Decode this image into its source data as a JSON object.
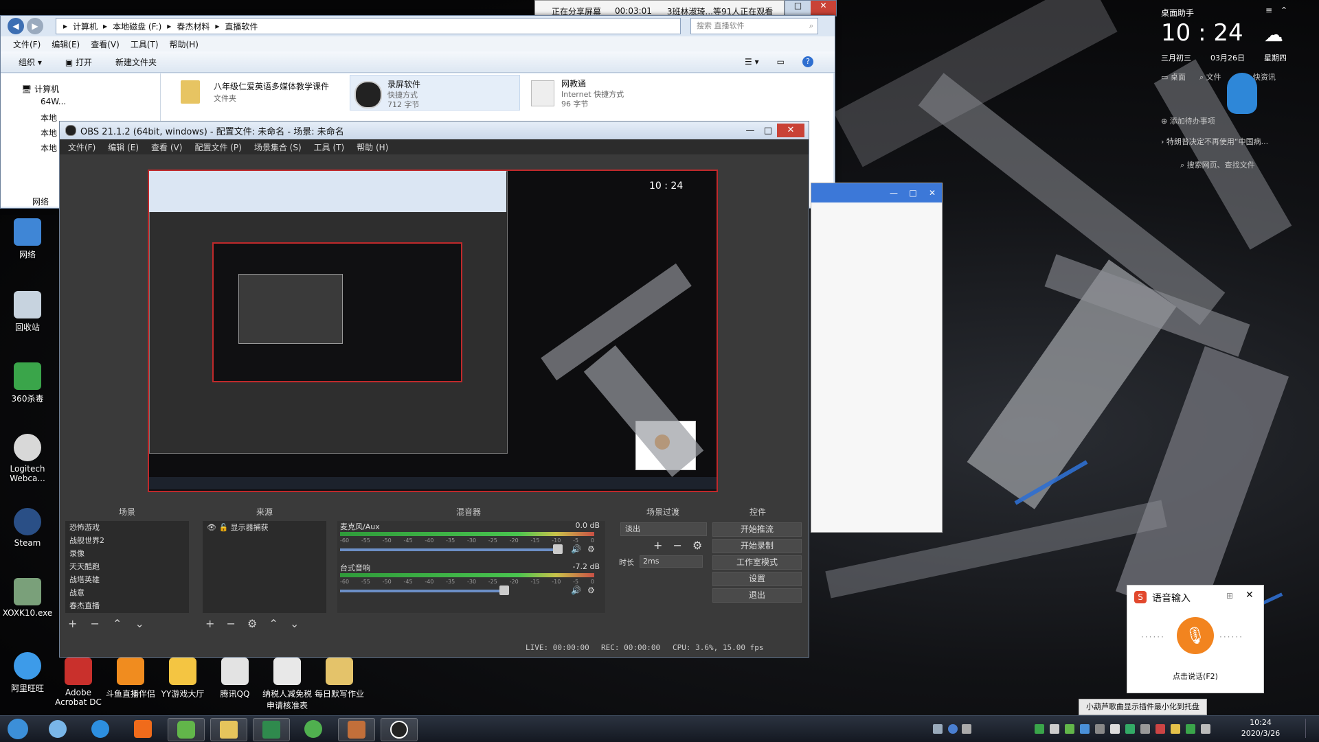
{
  "share_bar": {
    "status": "正在分享屏幕",
    "timer": "00:03:01",
    "viewers": "3班林淑琦...等91人正在观看"
  },
  "explorer": {
    "breadcrumb": [
      "计算机",
      "本地磁盘 (F:)",
      "春杰材料",
      "直播软件"
    ],
    "search_placeholder": "搜索 直播软件",
    "menu": [
      "文件(F)",
      "编辑(E)",
      "查看(V)",
      "工具(T)",
      "帮助(H)"
    ],
    "toolbar": {
      "organize": "组织 ▾",
      "open": "打开",
      "new_folder": "新建文件夹"
    },
    "tree": [
      "计算机",
      "64W...",
      "本地",
      "本地",
      "本地",
      "网络"
    ],
    "files": [
      {
        "name": "八年级仁爱英语多媒体教学课件",
        "type": "文件夹",
        "size": ""
      },
      {
        "name": "录屏软件",
        "type": "快捷方式",
        "size": "712 字节"
      },
      {
        "name": "网教通",
        "type": "Internet 快捷方式",
        "size": "96 字节"
      }
    ]
  },
  "obs": {
    "title": "OBS 21.1.2 (64bit, windows) - 配置文件: 未命名 - 场景: 未命名",
    "menu": [
      "文件(F)",
      "编辑 (E)",
      "查看 (V)",
      "配置文件 (P)",
      "场景集合 (S)",
      "工具 (T)",
      "帮助 (H)"
    ],
    "panels": {
      "scenes_header": "场景",
      "sources_header": "来源",
      "mixer_header": "混音器",
      "transitions_header": "场景过渡",
      "controls_header": "控件"
    },
    "scenes": [
      "恐怖游戏",
      "战舰世界2",
      "录像",
      "天天酷跑",
      "战塔英雄",
      "战意",
      "春杰直播"
    ],
    "sources": [
      {
        "name": "显示器捕获"
      }
    ],
    "mixer": [
      {
        "name": "麦克风/Aux",
        "db": "0.0 dB",
        "level": 0.85
      },
      {
        "name": "台式音响",
        "db": "-7.2 dB",
        "level": 0.62
      }
    ],
    "meter_ticks": [
      "-60",
      "-55",
      "-50",
      "-45",
      "-40",
      "-35",
      "-30",
      "-25",
      "-20",
      "-15",
      "-10",
      "-5",
      "0"
    ],
    "transition": {
      "type": "淡出",
      "duration_label": "时长",
      "duration": "2ms"
    },
    "controls": [
      "开始推流",
      "开始录制",
      "工作室模式",
      "设置",
      "退出"
    ],
    "status": {
      "live": "LIVE: 00:00:00",
      "rec": "REC: 00:00:00",
      "cpu": "CPU: 3.6%, 15.00 fps"
    }
  },
  "widget": {
    "title": "桌面助手",
    "time": "10 : 24",
    "lunar": "三月初三",
    "date": "03月26日",
    "weekday": "星期四",
    "row1": [
      "桌面",
      "文件",
      "快资讯"
    ],
    "todo": "添加待办事项",
    "news": "特朗普决定不再使用“中国病...",
    "search": "搜索网页、查找文件"
  },
  "voice_input": {
    "title": "语音输入",
    "hint": "点击说话(F2)",
    "tooltip": "小葫芦歌曲显示插件最小化到托盘"
  },
  "desktop_icons": [
    {
      "label": "网络",
      "color": "#3f86d6"
    },
    {
      "label": "回收站",
      "color": "#c7d3df"
    },
    {
      "label": "360杀毒",
      "color": "#3aa54a"
    },
    {
      "label": "Logitech Webca...",
      "color": "#d8d8d8"
    },
    {
      "label": "Steam",
      "color": "#2a4f86"
    },
    {
      "label": "XOXK10.exe",
      "color": "#7aa07a"
    },
    {
      "label": "阿里旺旺",
      "color": "#3d9be9"
    }
  ],
  "bottom_icons": [
    {
      "label": "Adobe Acrobat DC",
      "color": "#c9302c"
    },
    {
      "label": "斗鱼直播伴侣",
      "color": "#f08c1f"
    },
    {
      "label": "YY游戏大厅",
      "color": "#f4c542"
    },
    {
      "label": "腾讯QQ",
      "color": "#e3e3e3"
    },
    {
      "label": "纳税人减免税申请核准表",
      "color": "#e8e8e8"
    },
    {
      "label": "每日默写作业",
      "color": "#e4c36a"
    }
  ],
  "taskbar": {
    "apps": [
      {
        "name": "start",
        "color": "#3c8fd8"
      },
      {
        "name": "qq-browser",
        "color": "#79b6e8"
      },
      {
        "name": "mi",
        "color": "#f06b1b"
      },
      {
        "name": "wechat",
        "color": "#62b64a"
      },
      {
        "name": "explorer",
        "color": "#e6c45c"
      },
      {
        "name": "excel",
        "color": "#2f8a4d"
      },
      {
        "name": "360",
        "color": "#50b04f"
      },
      {
        "name": "game",
        "color": "#c26f3a"
      },
      {
        "name": "obs",
        "color": "#ffffff"
      }
    ],
    "clock_time": "10:24",
    "clock_date": "2020/3/26"
  }
}
